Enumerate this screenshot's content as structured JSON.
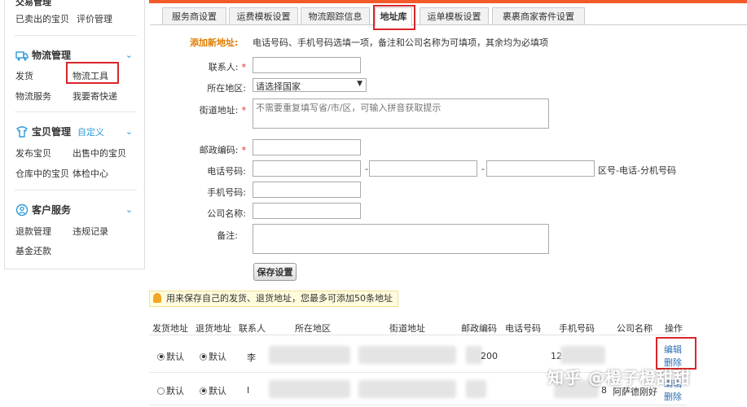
{
  "sidebar": {
    "top_partial": "交易管理",
    "top_links": [
      "已卖出的宝贝",
      "评价管理"
    ],
    "logistics": {
      "title": "物流管理",
      "links": [
        "发货",
        "物流工具",
        "物流服务",
        "我要寄快递"
      ]
    },
    "products": {
      "title": "宝贝管理",
      "custom": "自定义",
      "links": [
        "发布宝贝",
        "出售中的宝贝",
        "仓库中的宝贝",
        "体检中心"
      ]
    },
    "service": {
      "title": "客户服务",
      "links": [
        "退款管理",
        "违规记录",
        "基金还款"
      ]
    }
  },
  "tabs": [
    "服务商设置",
    "运费模板设置",
    "物流跟踪信息",
    "地址库",
    "运单模板设置",
    "裹裹商家寄件设置"
  ],
  "form": {
    "section_label": "添加新地址:",
    "section_note": "电话号码、手机号码选填一项，备注和公司名称为可填项，其余均为必填项",
    "contact_label": "联系人:",
    "region_label": "所在地区:",
    "region_value": "请选择国家",
    "street_label": "街道地址:",
    "street_placeholder": "不需要重复填写省/市/区，可输入拼音获取提示",
    "postcode_label": "邮政编码:",
    "phone_label": "电话号码:",
    "phone_sep": "-",
    "phone_hint": "区号-电话-分机号码",
    "mobile_label": "手机号码:",
    "company_label": "公司名称:",
    "remark_label": "备注:",
    "save_label": "保存设置",
    "required_mark": "*"
  },
  "tip": "用来保存自己的发货、退货地址，您最多可添加50条地址",
  "table": {
    "headers": [
      "发货地址",
      "退货地址",
      "联系人",
      "所在地区",
      "街道地址",
      "邮政编码",
      "电话号码",
      "手机号码",
      "公司名称",
      "操作"
    ],
    "rows": [
      {
        "ship": "默认",
        "ret": "默认",
        "contact": "李",
        "postcode": "200",
        "mobile": "12",
        "ops": [
          "编辑",
          "删除"
        ]
      },
      {
        "ship": "默认",
        "ret": "默认",
        "contact": "Ⅰ",
        "mobile": "8",
        "company": "阿萨德刚好",
        "ops": [
          "编辑",
          "删除"
        ]
      }
    ]
  },
  "watermark": "知乎 @橙子橙甜甜",
  "colors": {
    "accent": "#f35a2a",
    "link": "#2e9bd6",
    "highlight": "#d8262b",
    "orange_label": "#e07b00"
  }
}
